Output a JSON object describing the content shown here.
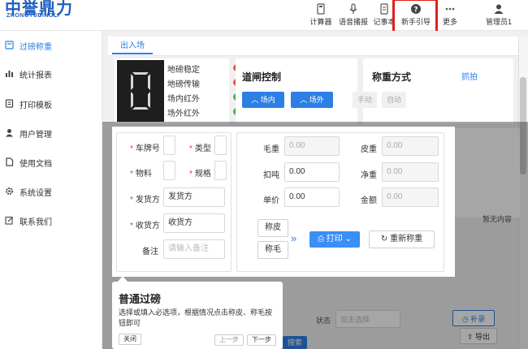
{
  "logo": {
    "main": "中誉鼎力",
    "sub": "ZHONGYUDINGLI"
  },
  "topbar": {
    "items": [
      {
        "label": "计算器",
        "icon": "calculator-icon"
      },
      {
        "label": "语音播报",
        "icon": "microphone-icon"
      },
      {
        "label": "记事本",
        "icon": "notepad-icon"
      },
      {
        "label": "新手引导",
        "icon": "help-icon"
      },
      {
        "label": "更多",
        "icon": "more-icon"
      },
      {
        "label": "管理员1",
        "icon": "user-icon"
      }
    ]
  },
  "sidebar": {
    "items": [
      {
        "label": "过磅称重",
        "icon": "scale-icon",
        "active": true
      },
      {
        "label": "统计报表",
        "icon": "bar-chart-icon"
      },
      {
        "label": "打印模板",
        "icon": "print-template-icon"
      },
      {
        "label": "用户管理",
        "icon": "user-icon"
      },
      {
        "label": "使用文档",
        "icon": "document-icon"
      },
      {
        "label": "系统设置",
        "icon": "gear-icon"
      },
      {
        "label": "联系我们",
        "icon": "edit-icon"
      }
    ]
  },
  "tab": {
    "label": "出入场"
  },
  "display": {
    "value": "0"
  },
  "status": [
    {
      "label": "地磅稳定",
      "state": "error",
      "color": "#e05a4f"
    },
    {
      "label": "地磅传输",
      "state": "error",
      "color": "#e05a4f"
    },
    {
      "label": "场内红外",
      "state": "ok",
      "color": "#4cae4c"
    },
    {
      "label": "场外红外",
      "state": "ok",
      "color": "#4cae4c"
    }
  ],
  "gate": {
    "title": "道闸控制",
    "btn_in": "场内",
    "btn_out": "场外"
  },
  "weigh_mode": {
    "title": "称重方式",
    "manual": "手动",
    "auto": "自动",
    "capture": "抓拍"
  },
  "ghost_text": "暂无内容",
  "form": {
    "plate_label": "车牌号",
    "type_label": "类型",
    "material_label": "物料",
    "spec_label": "规格",
    "shipper_label": "发货方",
    "shipper_value": "发货方",
    "receiver_label": "收货方",
    "receiver_value": "收货方",
    "remark_label": "备注",
    "remark_placeholder": "请输入备注",
    "gross_label": "毛重",
    "gross_value": "0.00",
    "tare_label": "皮重",
    "tare_value": "0.00",
    "deduct_label": "扣吨",
    "deduct_value": "0.00",
    "net_label": "净重",
    "net_value": "0.00",
    "price_label": "单价",
    "price_value": "0.00",
    "amount_label": "金额",
    "amount_value": "0.00",
    "weigh_tare_btn": "称皮",
    "weigh_gross_btn": "称毛",
    "print_btn": "打印",
    "reweigh_btn": "重新称重"
  },
  "guide": {
    "title": "普通过磅",
    "text": "选择或填入必选项，根据情况点击称皮、称毛按钮即可",
    "close": "关闭",
    "prev": "上一步",
    "next": "下一步"
  },
  "bottom": {
    "status_label": "状态",
    "status_placeholder": "双击选择",
    "supplement_btn": "补录",
    "export_btn": "导出",
    "search_btn": "搜索"
  },
  "colors": {
    "accent": "#2d7fe6",
    "highlight": "#e0201c"
  }
}
